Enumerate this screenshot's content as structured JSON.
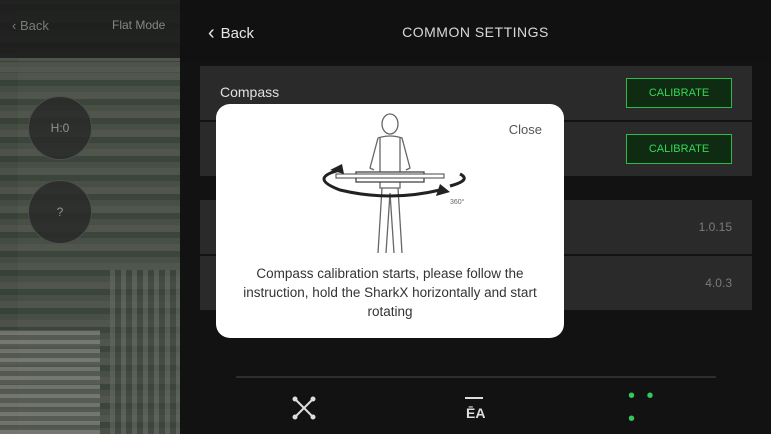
{
  "map": {
    "back_label": "Back",
    "title": "Flat Mode",
    "btn1": "H:0",
    "btn2": "?"
  },
  "header": {
    "back_label": "Back",
    "title": "COMMON SETTINGS"
  },
  "settings": {
    "compass_label": "Compass",
    "calibrate_label": "CALIBRATE",
    "calibrate2_label": "CALIBRATE",
    "row3_value": "1.0.15",
    "row4_value": "4.0.3"
  },
  "modal": {
    "close_label": "Close",
    "instruction": "Compass calibration starts, please follow the instruction, hold the SharkX horizontally and start rotating",
    "rotation_label": "360°"
  },
  "tabs": {
    "more_label": "• • •"
  },
  "colors": {
    "accent": "#34c759",
    "background": "#121212",
    "modal_bg": "#ffffff"
  }
}
